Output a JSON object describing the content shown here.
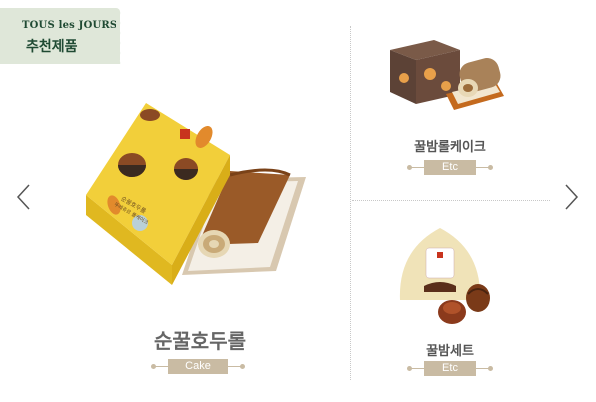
{
  "badge": {
    "brand": "TOUS les JOURS",
    "title": "추천제품"
  },
  "nav": {
    "prev_icon": "chevron-left-icon",
    "next_icon": "chevron-right-icon"
  },
  "featured": {
    "name": "순꿀호두롤",
    "category": "Cake",
    "box_text_1": "순꿀호두롤",
    "box_text_2": "뚜레쥬르 롤케이크"
  },
  "side_products": [
    {
      "name": "꿀밤롤케이크",
      "category": "Etc"
    },
    {
      "name": "꿀밤세트",
      "category": "Etc"
    }
  ],
  "colors": {
    "badge_bg": "#dfe7d9",
    "badge_text": "#1f4a33",
    "tag": "#c9bba3",
    "box_yellow": "#f2cf3a",
    "chestnut": "#8b4a24"
  }
}
